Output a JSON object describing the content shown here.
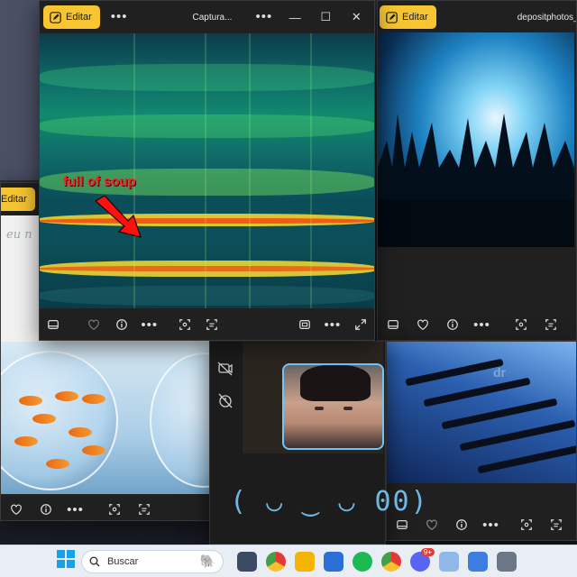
{
  "windows": {
    "spectrogram": {
      "edit_label": "Editar",
      "title": "Captura...",
      "annotation": "full of soup"
    },
    "concert": {
      "edit_label": "Editar",
      "title": "depositphotos_..."
    },
    "fish": {
      "edit_label": "Editar",
      "partial_text": "eu n"
    },
    "piano": {
      "watermark": "dr"
    },
    "webcam": {
      "face": "( ◡ ‿ ◡ 00)"
    }
  },
  "taskbar": {
    "search_placeholder": "Buscar",
    "badge_count": "9+"
  },
  "colors": {
    "edit_button": "#f6c531",
    "webcam_border": "#6ec6ff",
    "annotation": "#ff2020"
  }
}
